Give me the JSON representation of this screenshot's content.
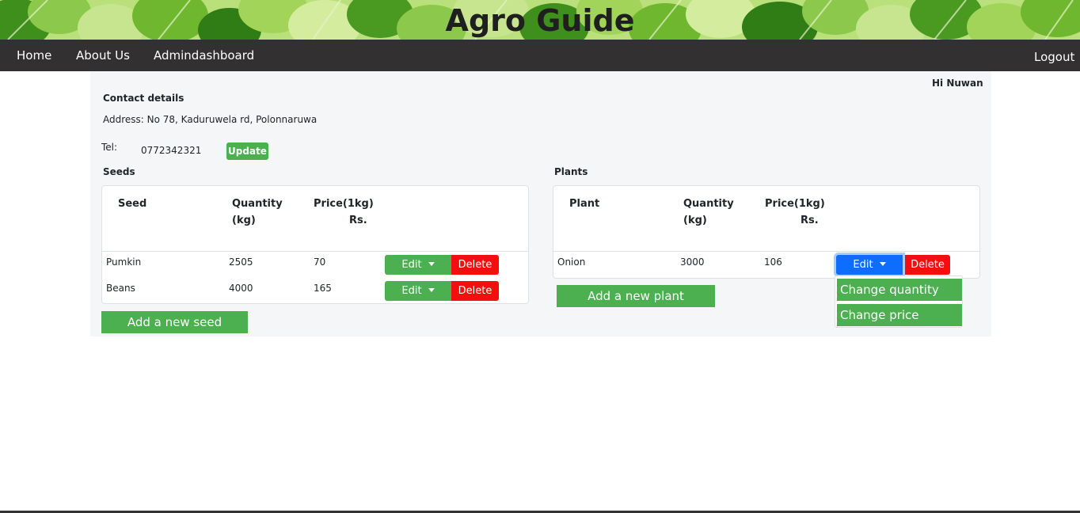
{
  "app": {
    "title": "Agro Guide"
  },
  "nav": {
    "items": [
      {
        "label": "Home"
      },
      {
        "label": "About Us"
      },
      {
        "label": "Admindashboard"
      }
    ],
    "logout": "Logout"
  },
  "user": {
    "greeting": "Hi Nuwan"
  },
  "contact": {
    "heading": "Contact details",
    "address": "Address: No 78, Kaduruwela rd, Polonnaruwa",
    "tel_label": "Tel:",
    "tel_value": "0772342321",
    "update_label": "Update"
  },
  "seeds": {
    "heading": "Seeds",
    "columns": {
      "name": "Seed",
      "qty_line1": "Quantity",
      "qty_line2": "(kg)",
      "price_line1": "Price(1kg)",
      "price_line2": "Rs."
    },
    "rows": [
      {
        "name": "Pumkin",
        "qty": "2505",
        "price": "70",
        "edit": "Edit",
        "delete": "Delete"
      },
      {
        "name": "Beans",
        "qty": "4000",
        "price": "165",
        "edit": "Edit",
        "delete": "Delete"
      }
    ],
    "add_label": "Add a new seed"
  },
  "plants": {
    "heading": "Plants",
    "columns": {
      "name": "Plant",
      "qty_line1": "Quantity",
      "qty_line2": "(kg)",
      "price_line1": "Price(1kg)",
      "price_line2": "Rs."
    },
    "rows": [
      {
        "name": "Onion",
        "qty": "3000",
        "price": "106",
        "edit": "Edit",
        "delete": "Delete"
      }
    ],
    "add_label": "Add a new plant",
    "dropdown": [
      {
        "label": "Change quantity"
      },
      {
        "label": "Change price"
      }
    ]
  },
  "colors": {
    "navbar": "#333031",
    "green": "#4caf50",
    "red": "#f40e0e",
    "blue_active": "#0d6efd",
    "panel": "#f5f6f8"
  },
  "icons": {
    "banner": "leaf-pattern",
    "caret": "caret-down-icon"
  }
}
